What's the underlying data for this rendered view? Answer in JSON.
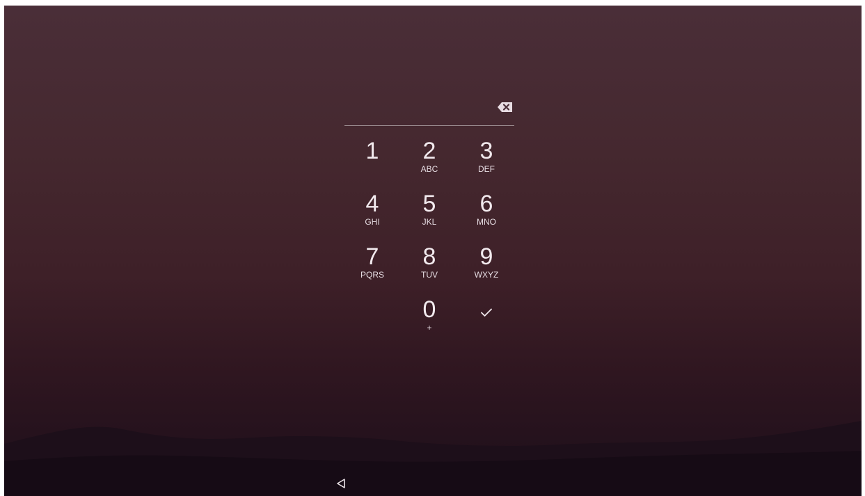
{
  "pin_entry": {
    "value": "",
    "backspace_icon": "backspace-icon"
  },
  "keypad": {
    "keys": [
      {
        "digit": "1",
        "letters": ""
      },
      {
        "digit": "2",
        "letters": "ABC"
      },
      {
        "digit": "3",
        "letters": "DEF"
      },
      {
        "digit": "4",
        "letters": "GHI"
      },
      {
        "digit": "5",
        "letters": "JKL"
      },
      {
        "digit": "6",
        "letters": "MNO"
      },
      {
        "digit": "7",
        "letters": "PQRS"
      },
      {
        "digit": "8",
        "letters": "TUV"
      },
      {
        "digit": "9",
        "letters": "WXYZ"
      },
      {
        "digit": "0",
        "letters": "+"
      }
    ],
    "confirm_icon": "checkmark-icon"
  },
  "nav_bar": {
    "back_icon": "back-triangle-icon"
  },
  "colors": {
    "text": "#f2eaee",
    "background_top": "#4a2e38",
    "background_bottom": "#1c0e1a"
  }
}
